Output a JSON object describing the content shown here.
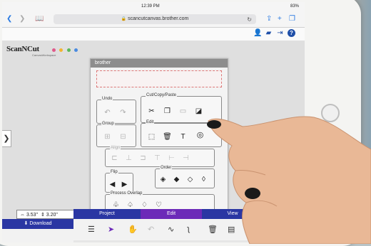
{
  "status": {
    "time": "12:39 PM",
    "battery": "83%"
  },
  "browser": {
    "url": "scancutcanvas.brother.com",
    "lock_icon": "lock-icon"
  },
  "app": {
    "logo_text": "ScanNCut",
    "logo_sub": "CanvasWorkspace",
    "brand": "brother"
  },
  "panel": {
    "groups": {
      "undo": "Undo",
      "cut_copy_paste": "Cut/Copy/Paste",
      "group": "Group",
      "edit": "Edit",
      "align": "Align",
      "flip": "Flip",
      "order": "Order",
      "process_overlap": "Process Overlap"
    }
  },
  "coords": {
    "width": "3.53\"",
    "height": "3.20\""
  },
  "tabs": {
    "download": "Download",
    "project": "Project",
    "edit": "Edit",
    "view": "View"
  },
  "colors": {
    "tab_blue": "#2a36a3",
    "tab_active": "#6c2ab8",
    "accent_blue": "#1f4fa8"
  }
}
